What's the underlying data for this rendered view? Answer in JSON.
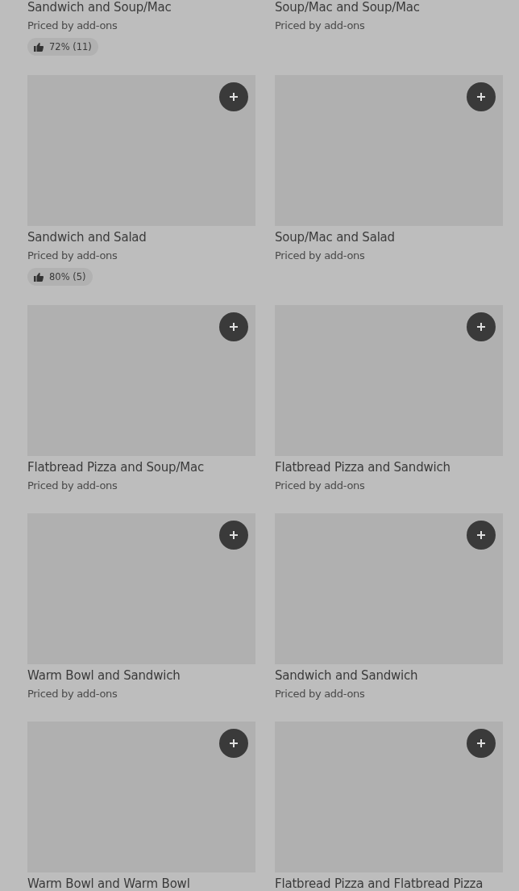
{
  "items": [
    {
      "kind": "partial",
      "title": "Sandwich and Soup/Mac",
      "subtitle": "Priced by add-ons",
      "rating": "72% (11)"
    },
    {
      "kind": "partial",
      "title": "Soup/Mac and Soup/Mac",
      "subtitle": "Priced by add-ons"
    },
    {
      "kind": "full",
      "title": "Sandwich and Salad",
      "subtitle": "Priced by add-ons",
      "rating": "80% (5)"
    },
    {
      "kind": "full",
      "title": "Soup/Mac and Salad",
      "subtitle": "Priced by add-ons"
    },
    {
      "kind": "full",
      "title": "Flatbread Pizza and Soup/Mac",
      "subtitle": "Priced by add-ons"
    },
    {
      "kind": "full",
      "title": "Flatbread Pizza and Sandwich",
      "subtitle": "Priced by add-ons"
    },
    {
      "kind": "full",
      "title": "Warm Bowl and Sandwich",
      "subtitle": "Priced by add-ons"
    },
    {
      "kind": "full",
      "title": "Sandwich and Sandwich",
      "subtitle": "Priced by add-ons"
    },
    {
      "kind": "full",
      "title": "Warm Bowl and Warm Bowl"
    },
    {
      "kind": "full",
      "title": "Flatbread Pizza and Flatbread Pizza"
    }
  ]
}
